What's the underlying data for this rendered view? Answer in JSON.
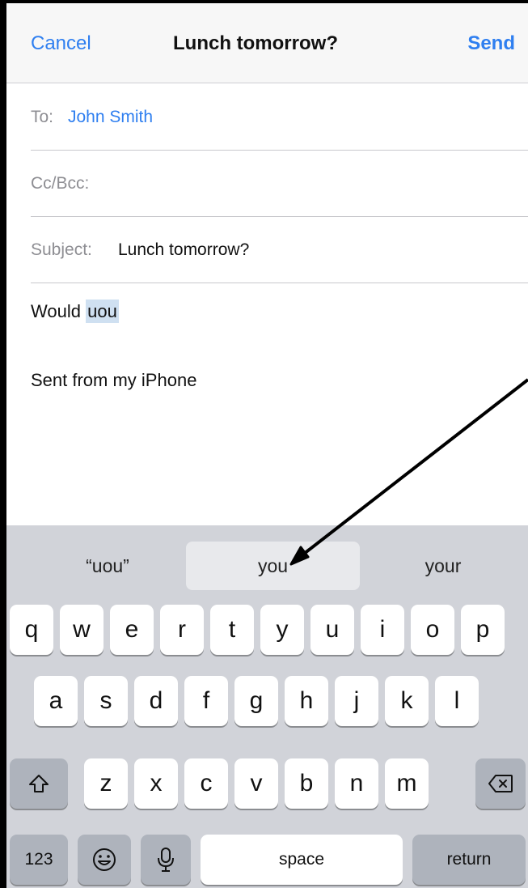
{
  "nav": {
    "cancel": "Cancel",
    "title": "Lunch tomorrow?",
    "send": "Send"
  },
  "fields": {
    "to_label": "To:",
    "to_value": "John Smith",
    "cc_label": "Cc/Bcc:",
    "subject_label": "Subject:",
    "subject_value": "Lunch tomorrow?"
  },
  "body": {
    "typed_prefix": "Would",
    "typed_highlighted": "uou",
    "signature": "Sent from my iPhone"
  },
  "predictions": [
    "“uou”",
    "you",
    "your"
  ],
  "keyboard": {
    "row1": [
      "q",
      "w",
      "e",
      "r",
      "t",
      "y",
      "u",
      "i",
      "o",
      "p"
    ],
    "row2": [
      "a",
      "s",
      "d",
      "f",
      "g",
      "h",
      "j",
      "k",
      "l"
    ],
    "row3": [
      "z",
      "x",
      "c",
      "v",
      "b",
      "n",
      "m"
    ],
    "numbers_label": "123",
    "space_label": "space",
    "return_label": "return"
  },
  "colors": {
    "accent": "#2f7ff0",
    "highlight": "#cfe0f1",
    "keyboard_bg": "#d1d3d9"
  }
}
